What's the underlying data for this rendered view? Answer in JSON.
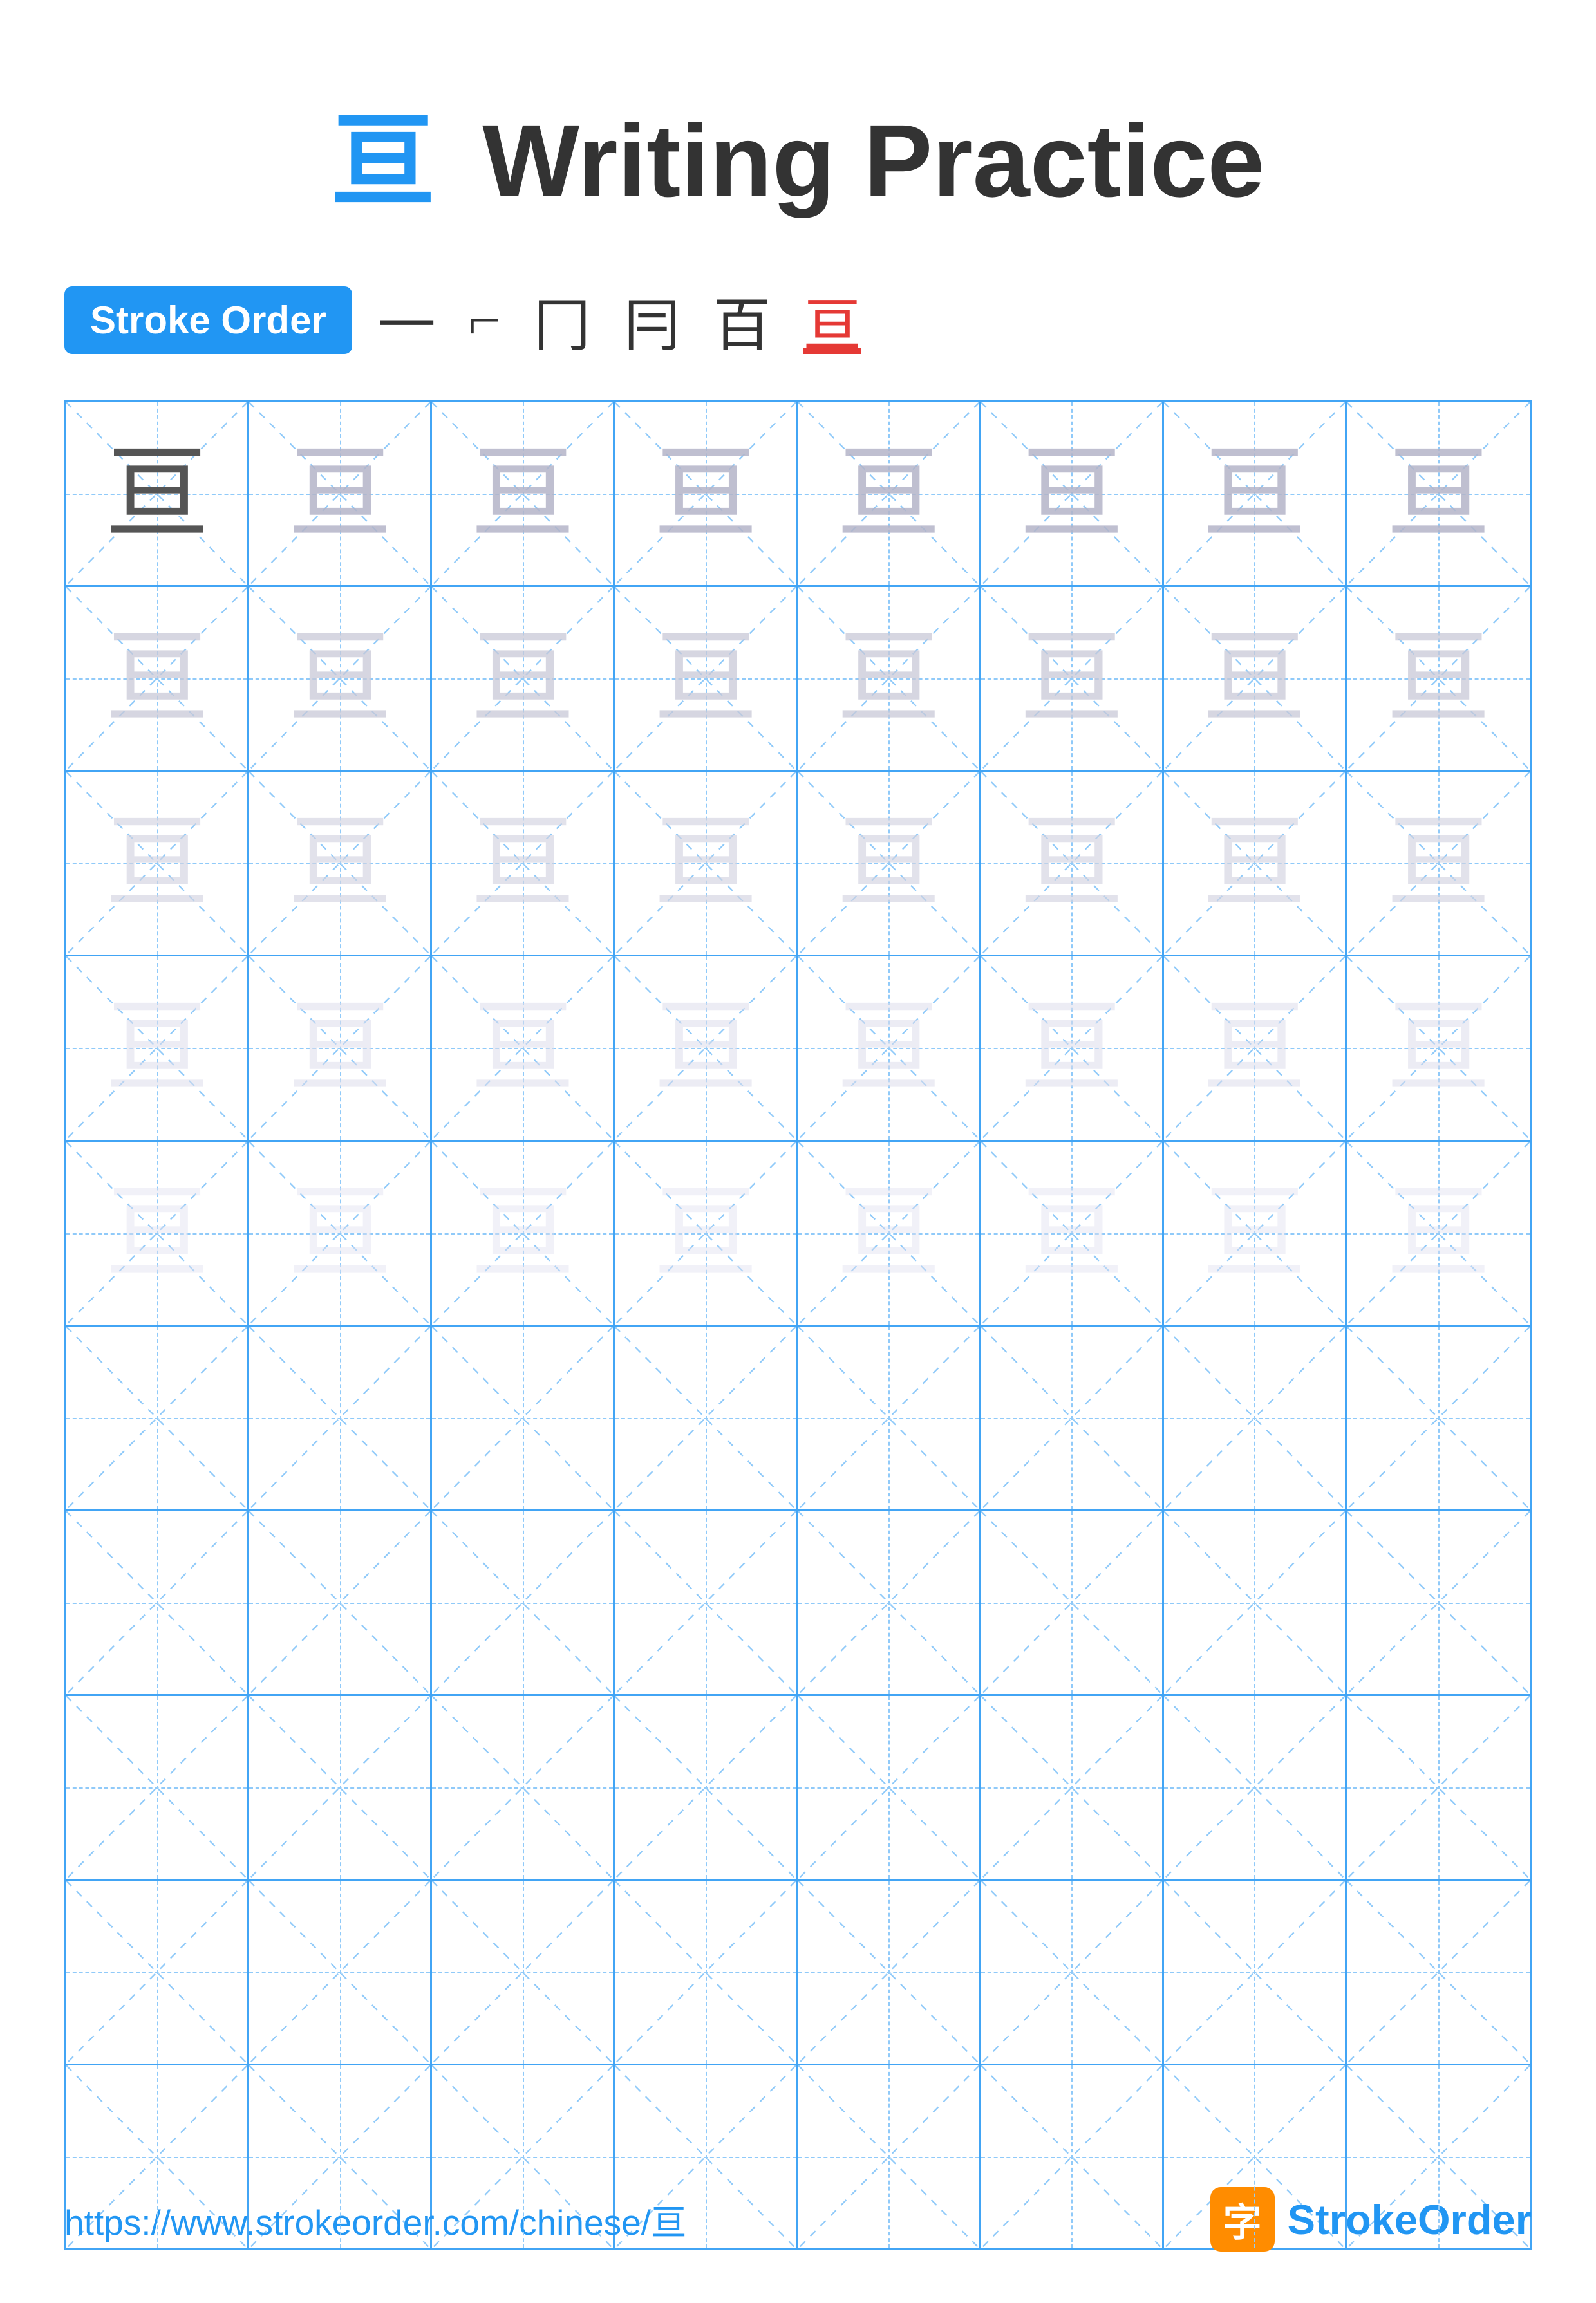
{
  "title": {
    "char": "亘",
    "label": "Writing Practice"
  },
  "stroke_order": {
    "badge_label": "Stroke Order",
    "strokes": [
      "一",
      "⌐",
      "冂",
      "冃",
      "百",
      "亘"
    ]
  },
  "grid": {
    "rows": 10,
    "cols": 8,
    "char": "亘",
    "filled_rows": 5,
    "empty_rows": 5
  },
  "footer": {
    "url": "https://www.strokeorder.com/chinese/亘",
    "brand_char": "字",
    "brand_name_blue": "Stroke",
    "brand_name_black": "Order"
  }
}
